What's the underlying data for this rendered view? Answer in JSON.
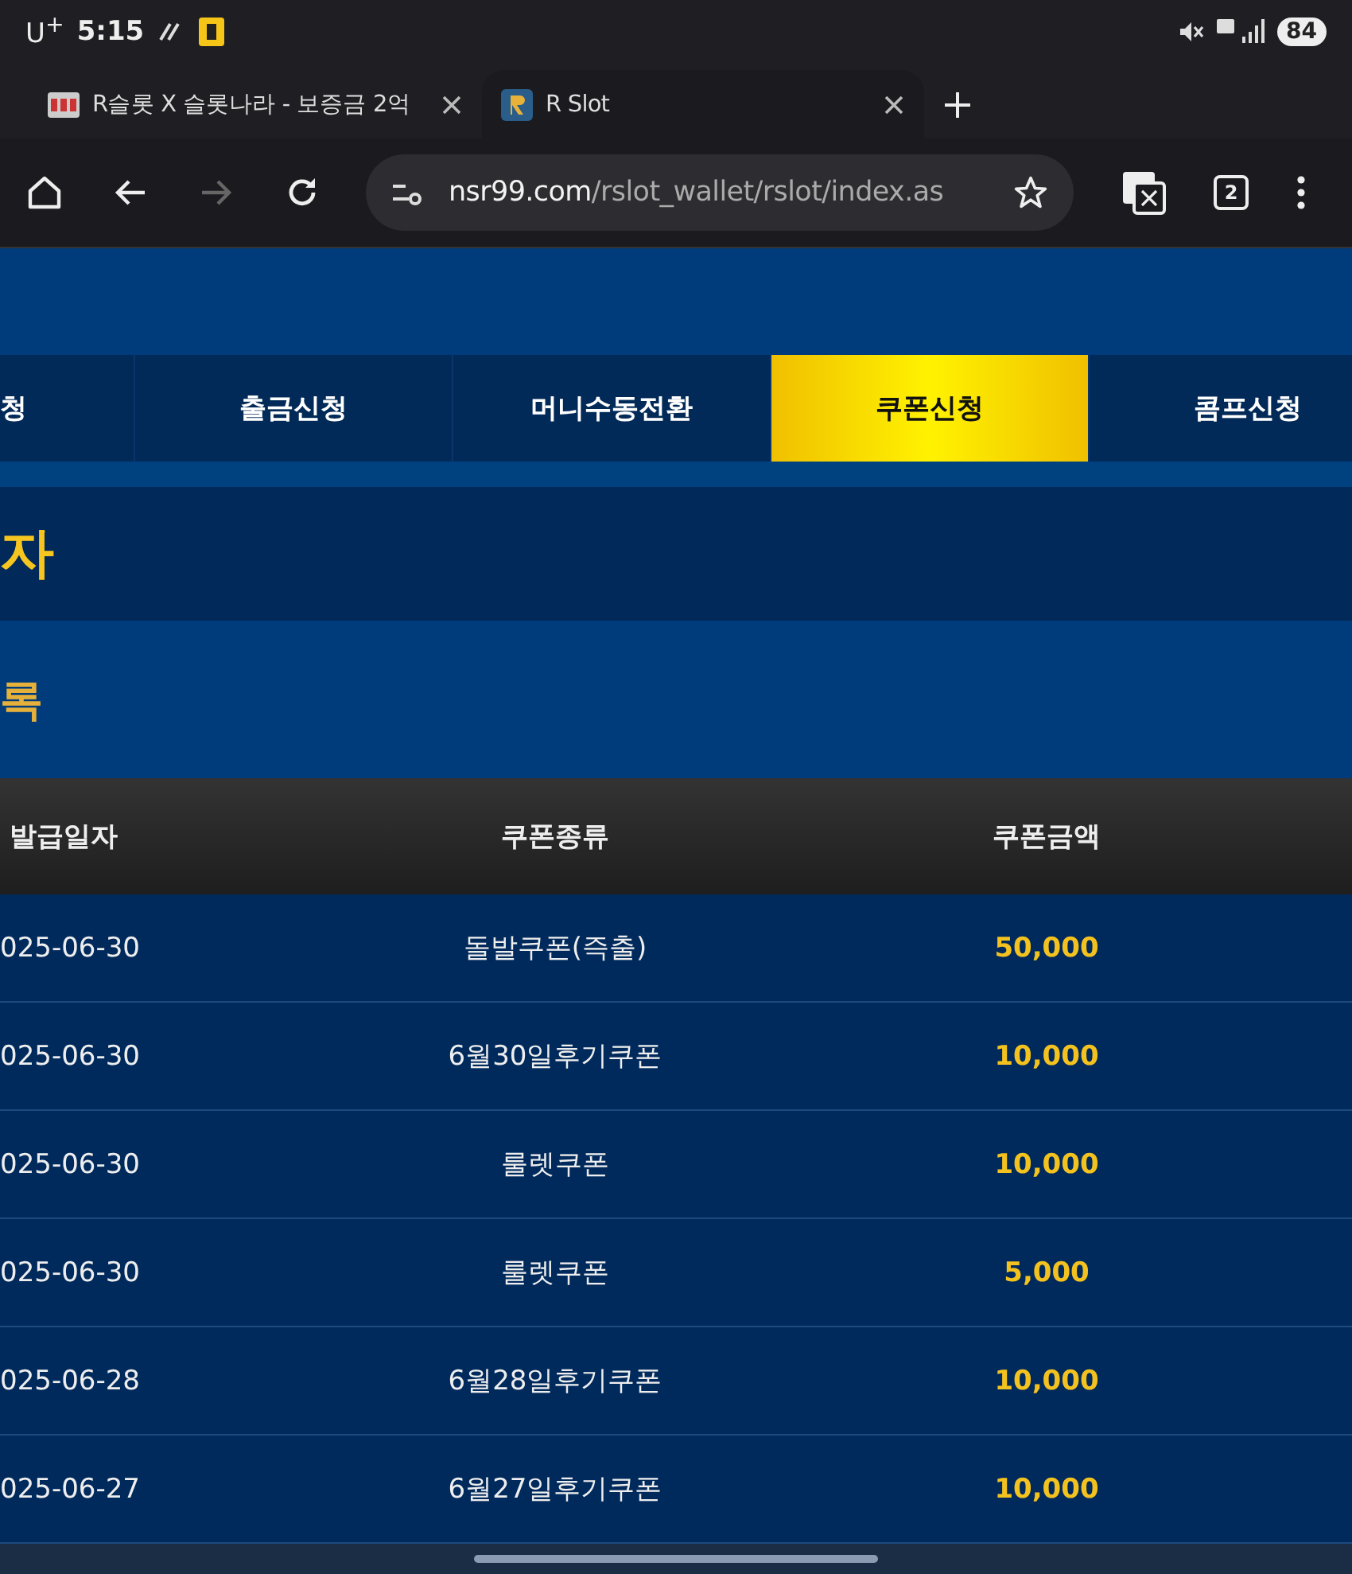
{
  "status_bar": {
    "carrier": "U$^{+}$",
    "time": "5:15",
    "battery": "84"
  },
  "browser_tabs": [
    {
      "title": "R슬롯 X 슬롯나라 - 보증금 2억",
      "selected": false
    },
    {
      "title": "R Slot",
      "selected": true
    }
  ],
  "address_bar": {
    "domain": "nsr99.com",
    "path": "/rslot_wallet/rslot/index.as",
    "tab_count": "2"
  },
  "nav": [
    {
      "label": "청",
      "selected": false
    },
    {
      "label": "출금신청",
      "selected": false
    },
    {
      "label": "머니수동전환",
      "selected": false
    },
    {
      "label": "쿠폰신청",
      "selected": true
    },
    {
      "label": "콤프신청",
      "selected": false
    }
  ],
  "page_title": "자",
  "section_title": "록",
  "table": {
    "columns": [
      "발급일자",
      "쿠폰종류",
      "쿠폰금액"
    ],
    "rows": [
      {
        "date": "025-06-30",
        "type": "돌발쿠폰(즉출)",
        "amount": "50,000"
      },
      {
        "date": "025-06-30",
        "type": "6월30일후기쿠폰",
        "amount": "10,000"
      },
      {
        "date": "025-06-30",
        "type": "룰렛쿠폰",
        "amount": "10,000"
      },
      {
        "date": "025-06-30",
        "type": "룰렛쿠폰",
        "amount": "5,000"
      },
      {
        "date": "025-06-28",
        "type": "6월28일후기쿠폰",
        "amount": "10,000"
      },
      {
        "date": "025-06-27",
        "type": "6월27일후기쿠폰",
        "amount": "10,000"
      }
    ]
  }
}
